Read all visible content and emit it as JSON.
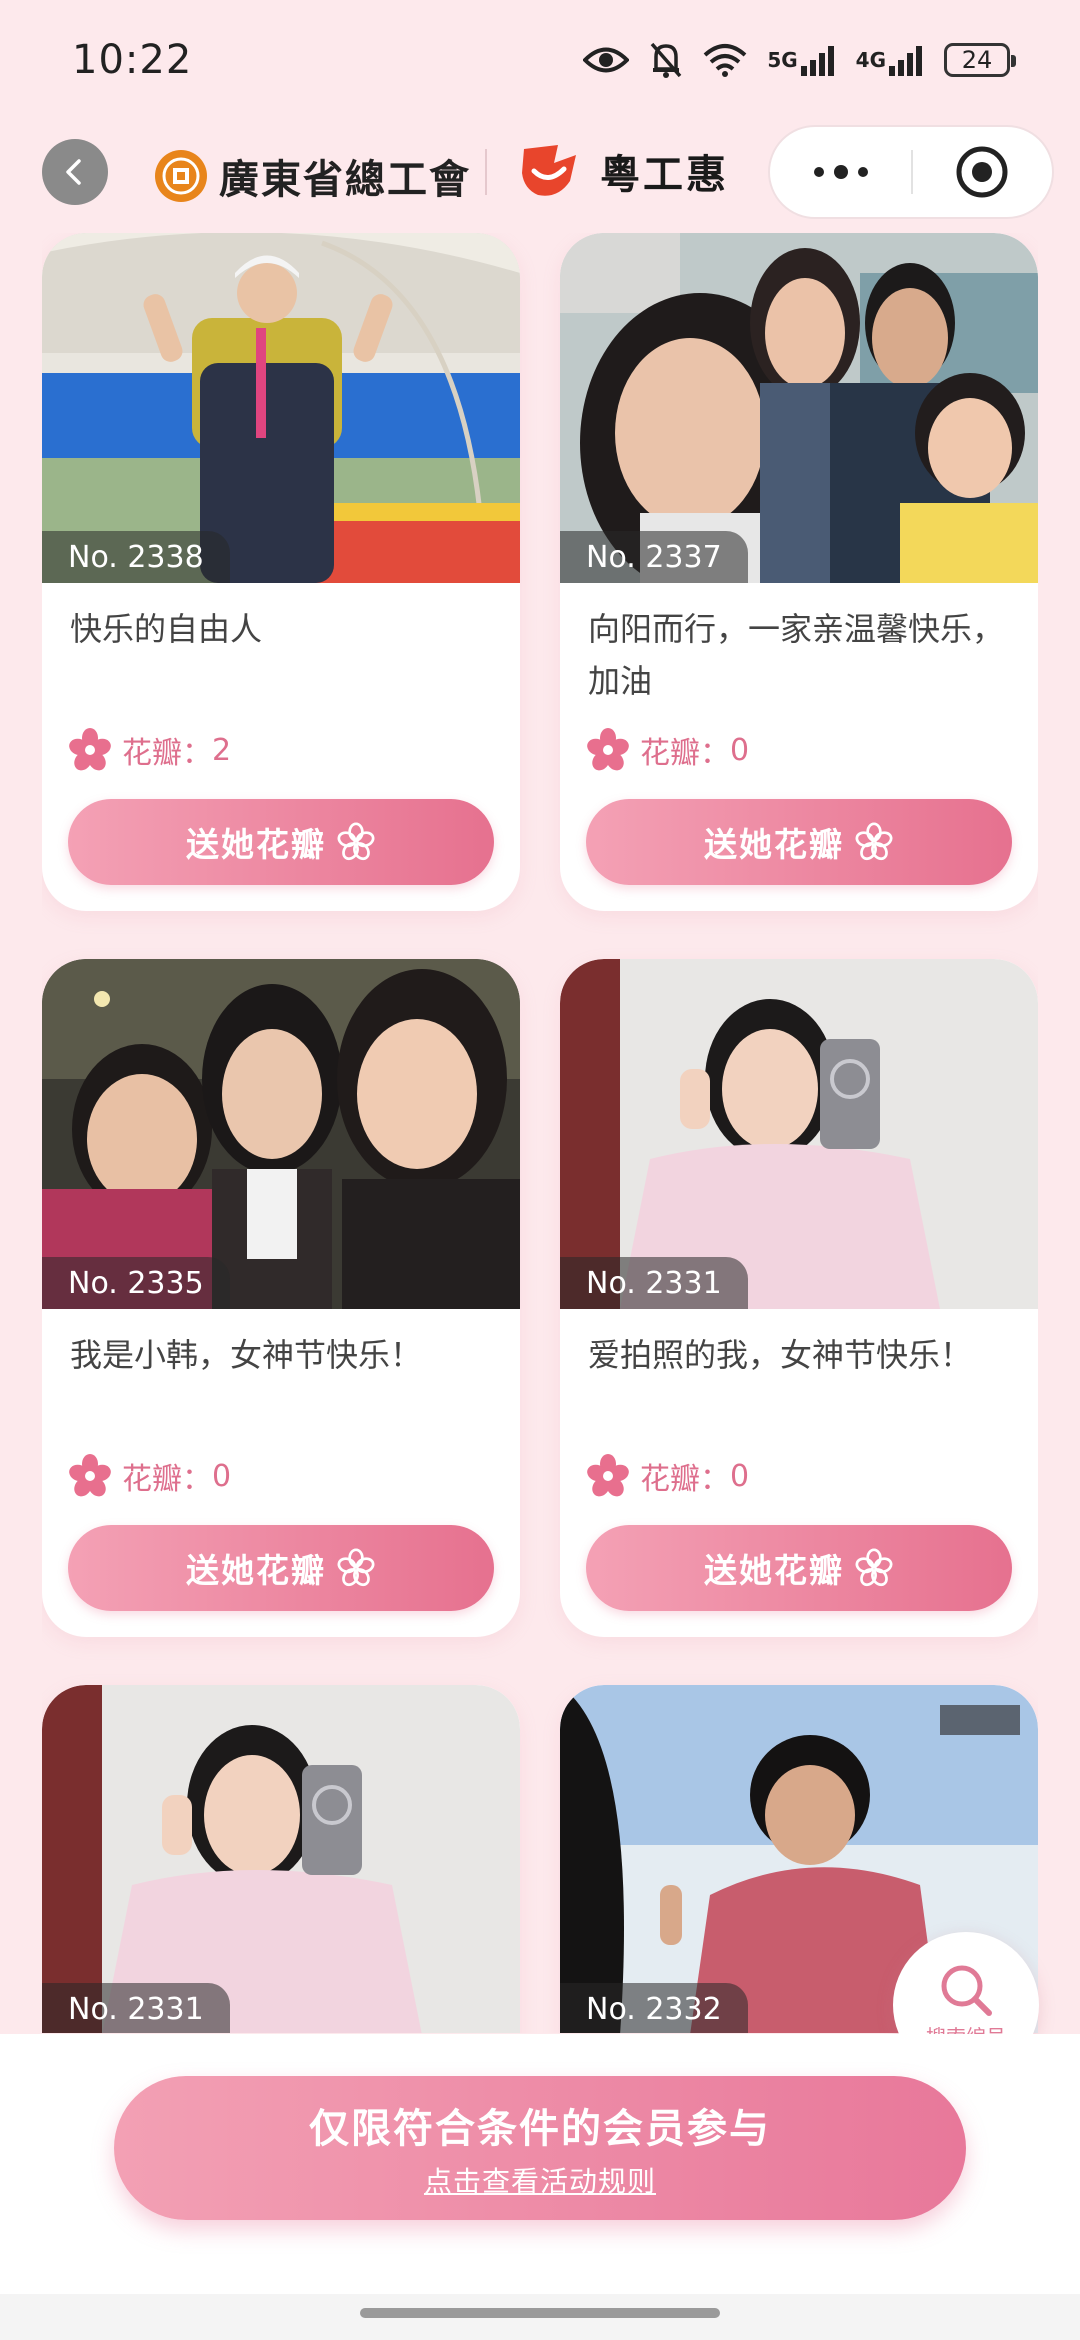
{
  "status_bar": {
    "time": "10:22",
    "network_1": "5G",
    "network_2": "4G",
    "battery": "24"
  },
  "header": {
    "union_name": "廣東省總工會",
    "brand_name": "粵工惠"
  },
  "cards": [
    {
      "number": "No. 2338",
      "caption": "快乐的自由人",
      "petals_label": "花瓣：",
      "petals_count": "2",
      "button_label": "送她花瓣"
    },
    {
      "number": "No. 2337",
      "caption": "向阳而行，一家亲温馨快乐，加油",
      "petals_label": "花瓣：",
      "petals_count": "0",
      "button_label": "送她花瓣"
    },
    {
      "number": "No. 2335",
      "caption": "我是小韩，女神节快乐！",
      "petals_label": "花瓣：",
      "petals_count": "0",
      "button_label": "送她花瓣"
    },
    {
      "number": "No. 2331",
      "caption": "爱拍照的我，女神节快乐！",
      "petals_label": "花瓣：",
      "petals_count": "0",
      "button_label": "送她花瓣"
    },
    {
      "number": "No. 2331",
      "caption": "",
      "petals_label": "",
      "petals_count": "",
      "button_label": ""
    },
    {
      "number": "No. 2332",
      "caption": "",
      "petals_label": "",
      "petals_count": "",
      "button_label": ""
    }
  ],
  "search_fab": {
    "label": "搜索编号"
  },
  "bottom": {
    "title": "仅限符合条件的会员参与",
    "link": "点击查看活动规则"
  },
  "colors": {
    "page_bg": "#fde9ec",
    "accent_pink": "#e6718f",
    "petal_pink": "#de6f8d"
  }
}
